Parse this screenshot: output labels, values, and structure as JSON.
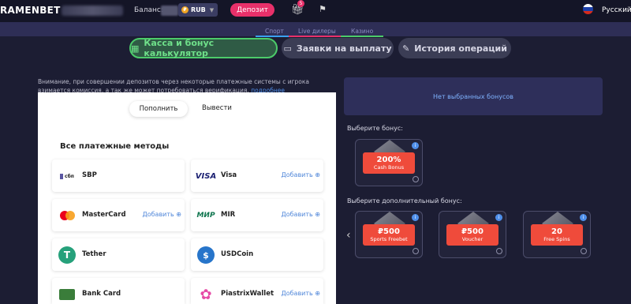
{
  "header": {
    "logo": "RAMENBET",
    "balance_label": "Баланс:",
    "currency": "RUB",
    "coin": "₽",
    "deposit": "Депозит",
    "gift_badge": "5",
    "language": "Русский"
  },
  "subnav": [
    "Спорт",
    "Live дилеры",
    "Казино"
  ],
  "tabs": {
    "cashier": "Касса и бонус калькулятор",
    "withdraw_requests": "Заявки на выплату",
    "history": "История операций"
  },
  "warning": {
    "text": "Внимание, при совершении депозитов через некоторые платежные системы с игрока взимается комиссия, а так же может потребоваться верификация.",
    "link": "подробнее"
  },
  "switch": {
    "deposit": "Пополнить",
    "withdraw": "Вывести"
  },
  "methods_title": "Все платежные методы",
  "methods": [
    {
      "name": "SBP",
      "add": ""
    },
    {
      "name": "Visa",
      "add": "Добавить"
    },
    {
      "name": "MasterCard",
      "add": "Добавить"
    },
    {
      "name": "MIR",
      "add": "Добавить"
    },
    {
      "name": "Tether",
      "add": ""
    },
    {
      "name": "USDCoin",
      "add": ""
    },
    {
      "name": "Bank Card",
      "add": ""
    },
    {
      "name": "PiastrixWallet",
      "add": "Добавить"
    }
  ],
  "icons": {
    "sbp": "сбп",
    "visa": "VISA",
    "mir": "МИР",
    "sbp_color": "#1a1a1a",
    "visa_color": "#1a1f71",
    "mir_color": "#0f754e",
    "tether_color": "#26a17b",
    "usdc_color": "#2775ca"
  },
  "bonus": {
    "none": "Нет выбранных бонусов",
    "choose": "Выберите бонус:",
    "choose_extra": "Выберите дополнительный бонус:"
  },
  "main_bonus": {
    "value": "200%",
    "label": "Cash Bonus"
  },
  "extra_bonuses": [
    {
      "value": "₽500",
      "label": "Sports Freebet"
    },
    {
      "value": "₽500",
      "label": "Voucher"
    },
    {
      "value": "20",
      "label": "Free Spins"
    }
  ],
  "colors": {
    "accent": "#e8306a",
    "green": "#4ccb6a",
    "bonus_red": "#ef4b3b",
    "link": "#4f86d9"
  }
}
